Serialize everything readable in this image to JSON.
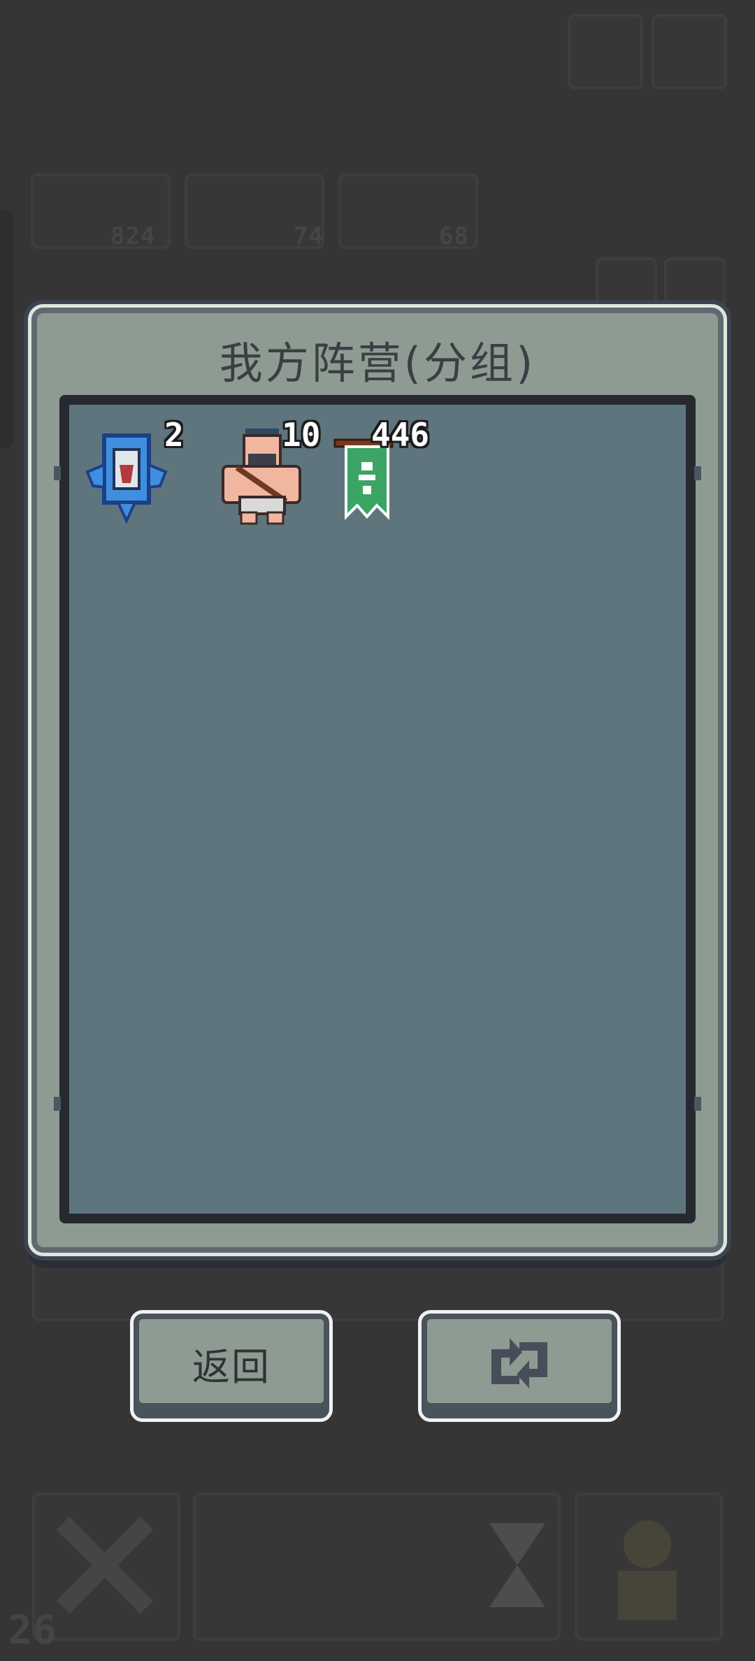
{
  "dialog": {
    "title": "我方阵营(分组)"
  },
  "units": [
    {
      "name": "blue-banner-unit",
      "count": "2",
      "icon": "blue-banner-icon"
    },
    {
      "name": "barbarian-unit",
      "count": "10",
      "icon": "barbarian-icon"
    },
    {
      "name": "green-flag-unit",
      "count": "446",
      "icon": "green-flag-icon"
    }
  ],
  "buttons": {
    "back_label": "返回",
    "refresh_icon": "refresh-icon"
  },
  "background": {
    "resource_counts": [
      "824",
      "74",
      "68"
    ],
    "turn_number": "26"
  }
}
